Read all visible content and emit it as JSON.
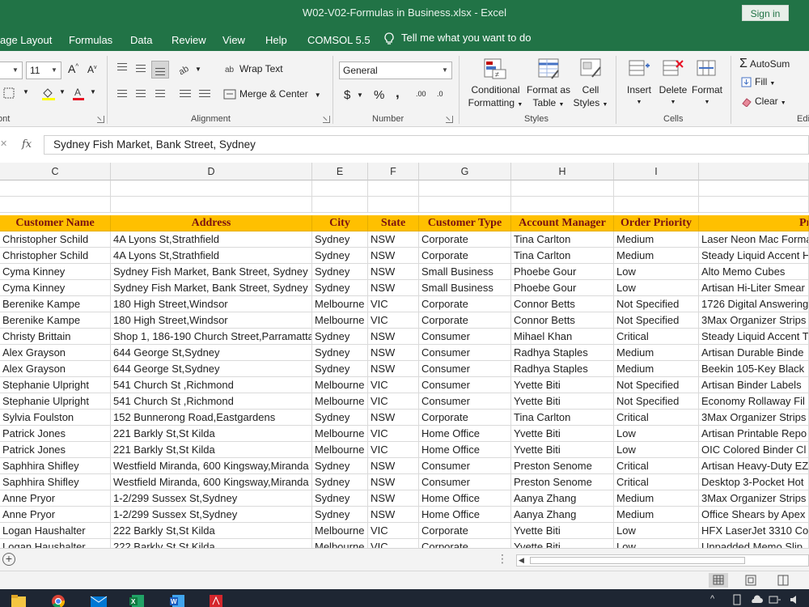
{
  "window": {
    "title": "W02-V02-Formulas in Business.xlsx  -  Excel",
    "sign_in": "Sign in"
  },
  "ribbon_tabs": [
    "age Layout",
    "Formulas",
    "Data",
    "Review",
    "View",
    "Help",
    "COMSOL 5.5"
  ],
  "tell_me": "Tell me what you want to do",
  "font_group": {
    "font_size": "11",
    "label": "ont",
    "grow_font": "A",
    "shrink_font": "A"
  },
  "alignment_group": {
    "wrap_text": "Wrap Text",
    "merge_center": "Merge & Center",
    "label": "Alignment"
  },
  "number_group": {
    "format": "General",
    "currency": "$",
    "percent": "%",
    "comma": ",",
    "increase_decimal": ".00",
    "decrease_decimal": ".0",
    "label": "Number"
  },
  "styles_group": {
    "conditional_formatting": [
      "Conditional",
      "Formatting"
    ],
    "format_as_table": [
      "Format as",
      "Table"
    ],
    "cell_styles": [
      "Cell",
      "Styles"
    ],
    "label": "Styles"
  },
  "cells_group": {
    "insert": "Insert",
    "delete": "Delete",
    "format": "Format",
    "label": "Cells"
  },
  "editing_group": {
    "autosum": "AutoSum",
    "fill": "Fill",
    "clear": "Clear",
    "label": "Edi"
  },
  "formula_bar": {
    "fx": "fx",
    "value": "Sydney Fish Market, Bank Street, Sydney"
  },
  "columns": [
    "C",
    "D",
    "E",
    "F",
    "G",
    "H",
    "I"
  ],
  "table_header": [
    "Customer Name",
    "Address",
    "City",
    "State",
    "Customer Type",
    "Account Manager",
    "Order Priority",
    "Pr"
  ],
  "rows": [
    [
      "Christopher Schild",
      "4A Lyons St,Strathfield",
      "Sydney",
      "NSW",
      "Corporate",
      "Tina Carlton",
      "Medium",
      "Laser Neon Mac Forma"
    ],
    [
      "Christopher Schild",
      "4A Lyons St,Strathfield",
      "Sydney",
      "NSW",
      "Corporate",
      "Tina Carlton",
      "Medium",
      "Steady Liquid Accent H"
    ],
    [
      "Cyma Kinney",
      "Sydney Fish Market, Bank Street, Sydney",
      "Sydney",
      "NSW",
      "Small Business",
      "Phoebe Gour",
      "Low",
      "Alto Memo Cubes"
    ],
    [
      "Cyma Kinney",
      "Sydney Fish Market, Bank Street, Sydney",
      "Sydney",
      "NSW",
      "Small Business",
      "Phoebe Gour",
      "Low",
      "Artisan Hi-Liter Smear"
    ],
    [
      "Berenike Kampe",
      "180 High Street,Windsor",
      "Melbourne",
      "VIC",
      "Corporate",
      "Connor Betts",
      "Not Specified",
      "1726 Digital Answering"
    ],
    [
      "Berenike Kampe",
      "180 High Street,Windsor",
      "Melbourne",
      "VIC",
      "Corporate",
      "Connor Betts",
      "Not Specified",
      "3Max Organizer Strips"
    ],
    [
      "Christy Brittain",
      "Shop 1, 186-190 Church Street,Parramatta",
      "Sydney",
      "NSW",
      "Consumer",
      "Mihael Khan",
      "Critical",
      "Steady Liquid Accent T"
    ],
    [
      "Alex Grayson",
      "644 George St,Sydney",
      "Sydney",
      "NSW",
      "Consumer",
      "Radhya Staples",
      "Medium",
      "Artisan Durable Binde"
    ],
    [
      "Alex Grayson",
      "644 George St,Sydney",
      "Sydney",
      "NSW",
      "Consumer",
      "Radhya Staples",
      "Medium",
      "Beekin 105-Key Black"
    ],
    [
      "Stephanie Ulpright",
      "541 Church St ,Richmond",
      "Melbourne",
      "VIC",
      "Consumer",
      "Yvette Biti",
      "Not Specified",
      "Artisan Binder Labels"
    ],
    [
      "Stephanie Ulpright",
      "541 Church St ,Richmond",
      "Melbourne",
      "VIC",
      "Consumer",
      "Yvette Biti",
      "Not Specified",
      "Economy Rollaway Fil"
    ],
    [
      "Sylvia Foulston",
      "152 Bunnerong Road,Eastgardens",
      "Sydney",
      "NSW",
      "Corporate",
      "Tina Carlton",
      "Critical",
      "3Max Organizer Strips"
    ],
    [
      "Patrick Jones",
      "221 Barkly St,St Kilda",
      "Melbourne",
      "VIC",
      "Home Office",
      "Yvette Biti",
      "Low",
      "Artisan Printable Repo"
    ],
    [
      "Patrick Jones",
      "221 Barkly St,St Kilda",
      "Melbourne",
      "VIC",
      "Home Office",
      "Yvette Biti",
      "Low",
      "OIC Colored Binder Cl"
    ],
    [
      "Saphhira Shifley",
      "Westfield Miranda, 600 Kingsway,Miranda",
      "Sydney",
      "NSW",
      "Consumer",
      "Preston Senome",
      "Critical",
      "Artisan Heavy-Duty EZ"
    ],
    [
      "Saphhira Shifley",
      "Westfield Miranda, 600 Kingsway,Miranda",
      "Sydney",
      "NSW",
      "Consumer",
      "Preston Senome",
      "Critical",
      "Desktop 3-Pocket Hot"
    ],
    [
      "Anne Pryor",
      "1-2/299 Sussex St,Sydney",
      "Sydney",
      "NSW",
      "Home Office",
      "Aanya Zhang",
      "Medium",
      "3Max Organizer Strips"
    ],
    [
      "Anne Pryor",
      "1-2/299 Sussex St,Sydney",
      "Sydney",
      "NSW",
      "Home Office",
      "Aanya Zhang",
      "Medium",
      "Office Shears by Apex"
    ],
    [
      "Logan Haushalter",
      "222 Barkly St,St Kilda",
      "Melbourne",
      "VIC",
      "Corporate",
      "Yvette Biti",
      "Low",
      "HFX LaserJet 3310 Cop"
    ],
    [
      "Logan Haushalter",
      "222 Barkly St,St Kilda",
      "Melbourne",
      "VIC",
      "Corporate",
      "Yvette Biti",
      "Low",
      "Unpadded Memo Slip"
    ]
  ],
  "colors": {
    "excel_green": "#217346",
    "header_fill": "#ffc000",
    "header_text": "#7a1111"
  }
}
